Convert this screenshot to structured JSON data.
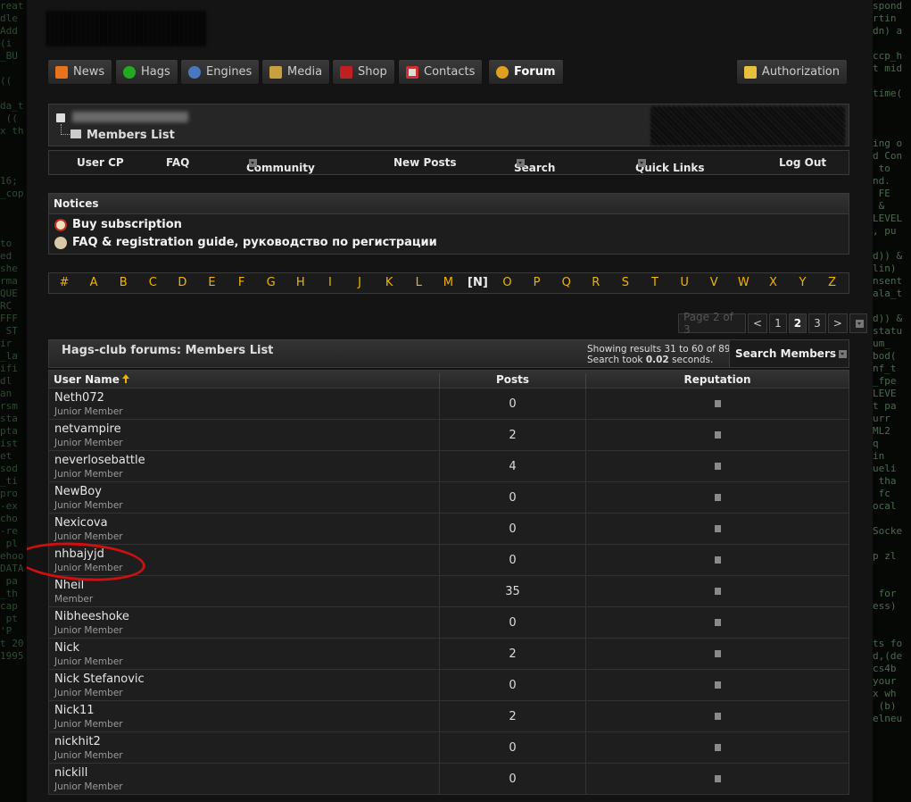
{
  "nav": {
    "items": [
      {
        "label": "News",
        "icon": "rss-icon",
        "color": "#e8731a"
      },
      {
        "label": "Hags",
        "icon": "green-circle-icon",
        "color": "#22aa22"
      },
      {
        "label": "Engines",
        "icon": "globe-icon",
        "color": "#4a78c0"
      },
      {
        "label": "Media",
        "icon": "media-icon",
        "color": "#c8a040"
      },
      {
        "label": "Shop",
        "icon": "gift-icon",
        "color": "#c02020"
      },
      {
        "label": "Contacts",
        "icon": "contacts-icon",
        "color": "#d03030"
      },
      {
        "label": "Forum",
        "icon": "smiley-icon",
        "color": "#e0a020",
        "active": true
      }
    ],
    "authorization": "Authorization"
  },
  "breadcrumb": {
    "current": "Members List"
  },
  "subnav": {
    "user_cp": "User CP",
    "faq": "FAQ",
    "community": "Community",
    "new_posts": "New Posts",
    "search": "Search",
    "quick_links": "Quick Links",
    "log_out": "Log Out"
  },
  "notices": {
    "title": "Notices",
    "items": [
      "Buy subscription",
      "FAQ & registration guide, руководство по регистрации"
    ]
  },
  "letters": [
    "#",
    "A",
    "B",
    "C",
    "D",
    "E",
    "F",
    "G",
    "H",
    "I",
    "J",
    "K",
    "L",
    "M",
    "[N]",
    "O",
    "P",
    "Q",
    "R",
    "S",
    "T",
    "U",
    "V",
    "W",
    "X",
    "Y",
    "Z"
  ],
  "current_letter": "[N]",
  "pager": {
    "label": "Page 2 of 3",
    "prev": "<",
    "pages": [
      "1",
      "2",
      "3"
    ],
    "current": "2",
    "next": ">"
  },
  "members": {
    "title": "Hags-club forums: Members List",
    "stats_line1": "Showing results 31 to 60 of 89",
    "stats_prefix": "Search took",
    "stats_time": "0.02",
    "stats_suffix": "seconds.",
    "search_label": "Search Members",
    "columns": {
      "user": "User Name",
      "posts": "Posts",
      "reputation": "Reputation"
    },
    "rows": [
      {
        "name": "Neth072",
        "rank": "Junior Member",
        "posts": "0"
      },
      {
        "name": "netvampire",
        "rank": "Junior Member",
        "posts": "2"
      },
      {
        "name": "neverlosebattle",
        "rank": "Junior Member",
        "posts": "4"
      },
      {
        "name": "NewBoy",
        "rank": "Junior Member",
        "posts": "0"
      },
      {
        "name": "Nexicova",
        "rank": "Junior Member",
        "posts": "0"
      },
      {
        "name": "nhbajyjd",
        "rank": "Junior Member",
        "posts": "0"
      },
      {
        "name": "Nheil",
        "rank": "Member",
        "posts": "35"
      },
      {
        "name": "Nibheeshoke",
        "rank": "Junior Member",
        "posts": "0"
      },
      {
        "name": "Nick",
        "rank": "Junior Member",
        "posts": "2"
      },
      {
        "name": "Nick Stefanovic",
        "rank": "Junior Member",
        "posts": "0"
      },
      {
        "name": "Nick11",
        "rank": "Junior Member",
        "posts": "2"
      },
      {
        "name": "nickhit2",
        "rank": "Junior Member",
        "posts": "0"
      },
      {
        "name": "nickill",
        "rank": "Junior Member",
        "posts": "0"
      }
    ]
  },
  "colors": {
    "accent": "#f0b400",
    "highlight": "#d01010"
  }
}
